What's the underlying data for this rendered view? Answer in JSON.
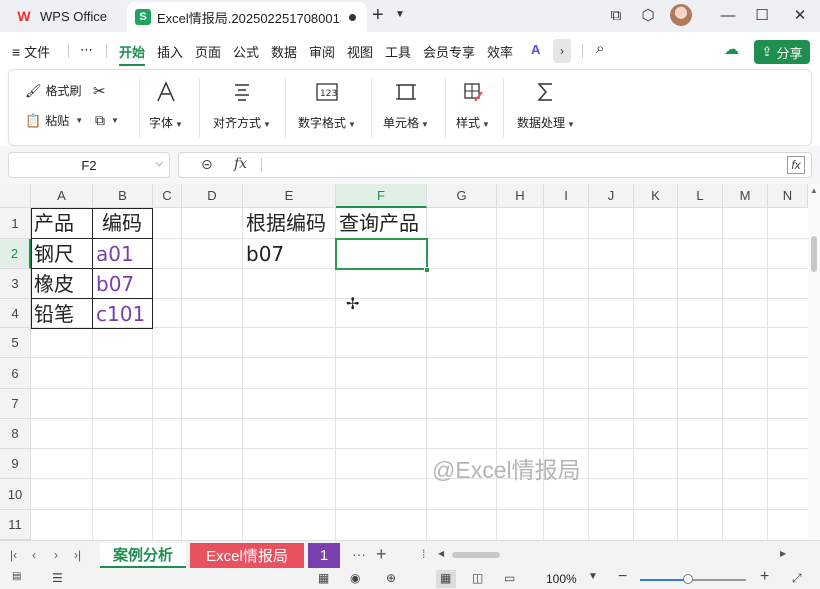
{
  "titlebar": {
    "app_tab": "WPS Office",
    "doc_tab": "Excel情报局.20250225170800131",
    "new_tab_symbol": "+",
    "window_buttons": [
      "⧉",
      "⬡",
      "—",
      "☐",
      "✕"
    ]
  },
  "menu": {
    "file": "文件",
    "more": "⋯",
    "items": [
      "开始",
      "插入",
      "页面",
      "公式",
      "数据",
      "审阅",
      "视图",
      "工具",
      "会员专享",
      "效率"
    ],
    "active": "开始",
    "share": "分享"
  },
  "ribbon": {
    "format_painter": "格式刷",
    "paste": "粘贴",
    "font": "字体",
    "alignment": "对齐方式",
    "number_format": "数字格式",
    "cells": "单元格",
    "styles": "样式",
    "data_processing": "数据处理"
  },
  "formula_bar": {
    "name_box": "F2",
    "fx": "fx",
    "formula": ""
  },
  "grid": {
    "columns": [
      "A",
      "B",
      "C",
      "D",
      "E",
      "F",
      "G",
      "H",
      "I",
      "J",
      "K",
      "L",
      "M",
      "N"
    ],
    "active_column": "F",
    "rows": [
      "1",
      "2",
      "3",
      "4",
      "5",
      "6",
      "7",
      "8",
      "9",
      "10",
      "11"
    ],
    "active_row": "2",
    "cells": {
      "A1": "产品",
      "B1": "编码",
      "A2": "钢尺",
      "B2": "a01",
      "A3": "橡皮",
      "B3": "b07",
      "A4": "铅笔",
      "B4": "c101",
      "E1": "根据编码",
      "F1": "查询产品",
      "E2": "b07",
      "F2": ""
    },
    "watermark": "@Excel情报局"
  },
  "sheets": {
    "tabs": [
      "案例分析",
      "Excel情报局",
      "1"
    ],
    "active": "案例分析",
    "more": "···",
    "add": "+"
  },
  "status": {
    "zoom": "100%",
    "zoom_level": 0.45
  },
  "colors": {
    "accent": "#1e8f4e",
    "purple_text": "#7b3fb0",
    "tab_red": "#e8525f",
    "tab_purple": "#7b3fb0"
  }
}
